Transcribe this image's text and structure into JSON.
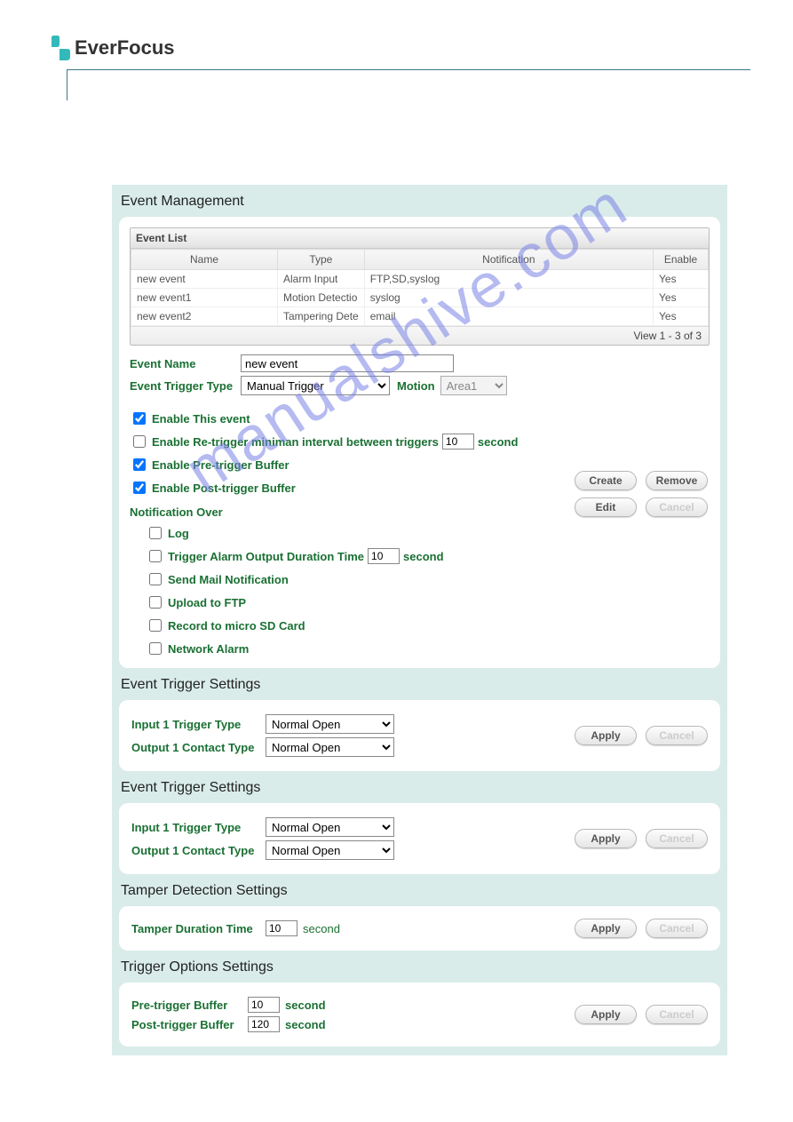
{
  "brand": "EverFocus",
  "watermark": "manualshive.com",
  "sections": {
    "eventManagement": {
      "title": "Event Management",
      "eventListTitle": "Event List",
      "columns": {
        "name": "Name",
        "type": "Type",
        "notification": "Notification",
        "enable": "Enable"
      },
      "rows": [
        {
          "name": "new event",
          "type": "Alarm Input",
          "notification": "FTP,SD,syslog",
          "enable": "Yes"
        },
        {
          "name": "new event1",
          "type": "Motion Detectio",
          "notification": "syslog",
          "enable": "Yes"
        },
        {
          "name": "new event2",
          "type": "Tampering Dete",
          "notification": "email",
          "enable": "Yes"
        }
      ],
      "footer": "View 1 - 3 of 3",
      "eventNameLabel": "Event Name",
      "eventNameValue": "new event",
      "triggerTypeLabel": "Event Trigger Type",
      "triggerTypeValue": "Manual Trigger",
      "motionLabel": "Motion",
      "motionValue": "Area1",
      "enableThis": "Enable This event",
      "enableRetrigger": "Enable Re-trigger miniman interval between triggers",
      "retriggerValue": "10",
      "second": "second",
      "enablePre": "Enable Pre-trigger Buffer",
      "enablePost": "Enable Post-trigger Buffer",
      "notifOver": "Notification Over",
      "notifs": {
        "log": "Log",
        "alarmOut": "Trigger Alarm Output Duration Time",
        "alarmOutValue": "10",
        "mail": "Send Mail Notification",
        "ftp": "Upload to FTP",
        "sd": "Record to micro SD Card",
        "net": "Network Alarm"
      },
      "buttons": {
        "create": "Create",
        "remove": "Remove",
        "edit": "Edit",
        "cancel": "Cancel"
      }
    },
    "trigger1": {
      "title": "Event Trigger Settings",
      "input1": "Input 1 Trigger Type",
      "output1": "Output 1 Contact Type",
      "inputValue": "Normal Open",
      "outputValue": "Normal Open",
      "apply": "Apply",
      "cancel": "Cancel"
    },
    "trigger2": {
      "title": "Event Trigger Settings",
      "input1": "Input 1 Trigger Type",
      "output1": "Output 1 Contact Type",
      "inputValue": "Normal Open",
      "outputValue": "Normal Open",
      "apply": "Apply",
      "cancel": "Cancel"
    },
    "tamper": {
      "title": "Tamper Detection Settings",
      "durLabel": "Tamper Duration Time",
      "durValue": "10",
      "second": "second",
      "apply": "Apply",
      "cancel": "Cancel"
    },
    "triggerOpts": {
      "title": "Trigger Options Settings",
      "preLabel": "Pre-trigger Buffer",
      "preValue": "10",
      "postLabel": "Post-trigger Buffer",
      "postValue": "120",
      "second": "second",
      "apply": "Apply",
      "cancel": "Cancel"
    }
  }
}
